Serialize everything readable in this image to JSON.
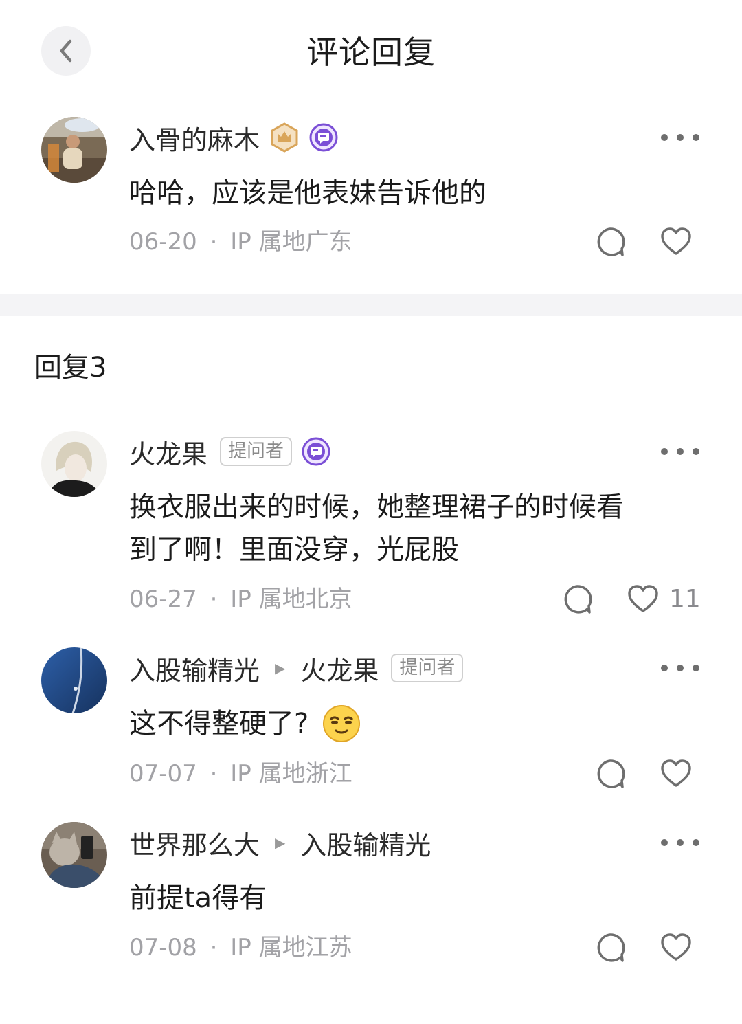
{
  "header": {
    "title": "评论回复",
    "back_icon": "chevron-left-icon"
  },
  "main_comment": {
    "username": "入骨的麻木",
    "badges": [
      "crown-badge-icon",
      "chat-badge-icon"
    ],
    "text": "哈哈，应该是他表妹告诉他的",
    "date": "06-20",
    "location": "IP 属地广东"
  },
  "replies_section": {
    "title": "回复3"
  },
  "replies": [
    {
      "username": "火龙果",
      "tag": "提问者",
      "text_line1": "换衣服出来的时候，她整理裙子的时候看",
      "text_line2": "到了啊！里面没穿，光屁股",
      "date": "06-27",
      "location": "IP 属地北京",
      "likes": "11"
    },
    {
      "username": "入股输精光",
      "reply_to": "火龙果",
      "reply_to_tag": "提问者",
      "text": "这不得整硬了?",
      "emoji": "smirk-emoji-icon",
      "date": "07-07",
      "location": "IP 属地浙江"
    },
    {
      "username": "世界那么大",
      "reply_to": "入股输精光",
      "text": "前提ta得有",
      "date": "07-08",
      "location": "IP 属地江苏"
    }
  ],
  "separator": "·",
  "colors": {
    "accent_purple": "#7b4fd6",
    "badge_gold": "#d9a55a",
    "meta_gray": "#a2a2a6"
  }
}
